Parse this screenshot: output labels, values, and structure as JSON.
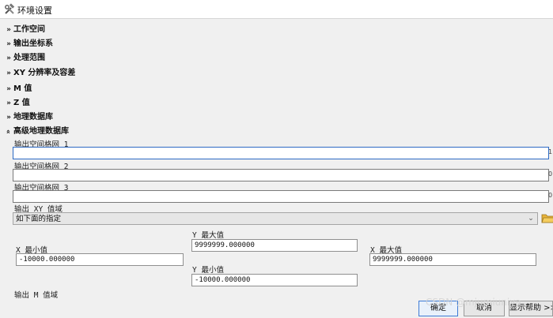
{
  "window": {
    "title": "环境设置",
    "icon": "hammer-wrench-icon"
  },
  "sections": [
    {
      "label": "工作空间",
      "state": "collapsed"
    },
    {
      "label": "输出坐标系",
      "state": "collapsed"
    },
    {
      "label": "处理范围",
      "state": "collapsed"
    },
    {
      "label": "XY 分辨率及容差",
      "state": "collapsed"
    },
    {
      "label": "M 值",
      "state": "collapsed"
    },
    {
      "label": "Z 值",
      "state": "collapsed"
    },
    {
      "label": "地理数据库",
      "state": "collapsed"
    },
    {
      "label": "高级地理数据库",
      "state": "expanded"
    }
  ],
  "advanced": {
    "grid1_label": "输出空间格网 1",
    "grid1_value": "",
    "grid1_edge": "1",
    "grid2_label": "输出空间格网 2",
    "grid2_value": "",
    "grid2_edge": "0",
    "grid3_label": "输出空间格网 3",
    "grid3_value": "",
    "grid3_edge": "0",
    "xy_domain_label": "输出 XY 值域",
    "xy_domain_selected": "如下面的指定",
    "xmin_label": "X 最小值",
    "xmin_value": "-10000.000000",
    "ymax_label": "Y 最大值",
    "ymax_value": "9999999.000000",
    "xmax_label": "X 最大值",
    "xmax_value": "9999999.000000",
    "ymin_label": "Y 最小值",
    "ymin_value": "-10000.000000",
    "m_domain_label": "输出 M 值域"
  },
  "buttons": {
    "ok": "确定",
    "cancel": "取消",
    "help": "显示帮助 >>"
  },
  "watermark": "CSDN @mjumiuniya",
  "colors": {
    "background": "#f0f0f0",
    "active_border": "#2d6ac4",
    "folder": "#e8b43a"
  }
}
